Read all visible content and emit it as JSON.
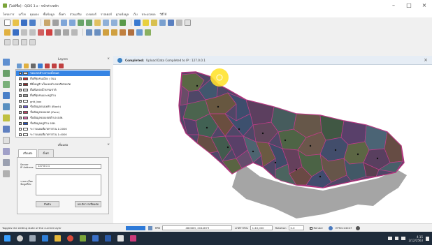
{
  "window": {
    "title": "[ไม่มีชื่อ] - QGIS 3.x - หน้าต่างหลัก",
    "controls": {
      "minimize": "–",
      "maximize": "□",
      "close": "×"
    }
  },
  "menubar": [
    "โครงการ",
    "แก้ไข",
    "มุมมอง",
    "ชั้นข้อมูล",
    "ตั้งค่า",
    "ส่วนเสริม",
    "เวกเตอร์",
    "ราสเตอร์",
    "ฐานข้อมูล",
    "เว็บ",
    "ประมวลผล",
    "วิธีใช้"
  ],
  "layers_panel": {
    "title": "Layers",
    "close": "×",
    "items": [
      {
        "label": "ขอบเขตตำบลรวมทั้งหมด",
        "checked": true,
        "swatch": "#e0e0e0",
        "selected": true
      },
      {
        "label": "พื้นที่ชุมชนเมือง / ถนน",
        "checked": true,
        "swatch": "#c03030",
        "selected": false
      },
      {
        "label": "ที่ตั้งหมู่บ้านในเขตอำเภอหรือจังหวัด",
        "checked": true,
        "swatch": "#8b2a2a",
        "selected": false
      },
      {
        "label": "พื้นที่แหล่งน้ำธรรมชาติ",
        "checked": true,
        "swatch": "#d0d0d0",
        "selected": false
      },
      {
        "label": "พื้นที่ชุมชนและหมู่บ้าน",
        "checked": true,
        "swatch": "#a0a0a0",
        "selected": false
      },
      {
        "label": "grid_box",
        "checked": true,
        "swatch": "#ffffff",
        "selected": false
      },
      {
        "label": "ชั้นข้อมูลถนนหลัก (Block)",
        "checked": true,
        "swatch": "#6a5acd",
        "selected": false
      },
      {
        "label": "ชั้นข้อมูลขอบเขต (Zone)",
        "checked": true,
        "swatch": "#c04060",
        "selected": false
      },
      {
        "label": "ชั้นข้อมูลขอบเขตตำบล อปท.",
        "checked": true,
        "swatch": "#d060a0",
        "selected": false
      },
      {
        "label": "ชั้นข้อมูลหมู่บ้าน อปท.",
        "checked": true,
        "swatch": "#2050c0",
        "selected": false
      },
      {
        "label": "ระวางแผนที่มาตราส่วน 1:2000",
        "checked": false,
        "swatch": "#ffffff",
        "selected": false
      },
      {
        "label": "ระวางแผนที่มาตราส่วน 1:4000",
        "checked": false,
        "swatch": "#ffffff",
        "selected": false
      }
    ]
  },
  "identify_panel": {
    "title": "เชื่อมต่อ",
    "close": "×",
    "tabs": [
      "เชื่อมต่อ",
      "ตั้งค่า"
    ],
    "server_label": "Server\nIP Address",
    "server_value": "127.0.0.1",
    "area_label": "รายละเอียด\nข้อมูลที่ส่ง",
    "buttons": [
      "ยืนยัน",
      "ยกเลิกการเชื่อมต่อ"
    ]
  },
  "message_bar": {
    "title": "Completed:",
    "text": "Upload Data Completed to IP : 127.0.0.1",
    "close": "×"
  },
  "status_bar": {
    "hint": "Toggles the editing state of the current layer",
    "coord_label": "พิกัด",
    "coord_value": "480083, 2044673",
    "scale_label": "มาตราส่วน",
    "scale_value": "1:40,000",
    "rotation_label": "Rotation",
    "rotation_value": "0.0",
    "render_label": "Render",
    "crs": "EPSG:24047"
  },
  "taskbar": {
    "time": "4:15",
    "date": "2/12/2563"
  },
  "colors": {
    "accent": "#3584e4",
    "highlight": "#ffe22a",
    "map_outline": "#b0307a"
  }
}
